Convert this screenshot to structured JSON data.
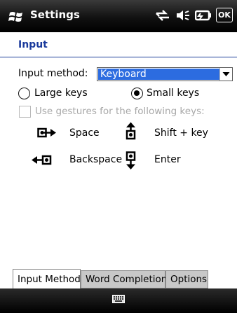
{
  "titlebar": {
    "app_title": "Settings",
    "ok_label": "OK",
    "icons": [
      "windows-logo-icon",
      "connectivity-icon",
      "volume-icon",
      "battery-icon"
    ]
  },
  "page": {
    "title": "Input"
  },
  "input_method": {
    "label": "Input method:",
    "value": "Keyboard",
    "options": [
      "Keyboard"
    ]
  },
  "keys": {
    "large_label": "Large keys",
    "small_label": "Small keys",
    "selected": "small"
  },
  "gestures": {
    "checkbox_label": "Use gestures for the following keys:",
    "checked": false,
    "enabled": false,
    "items": [
      {
        "label": "Space",
        "icon": "space-gesture-icon"
      },
      {
        "label": "Shift + key",
        "icon": "shift-gesture-icon"
      },
      {
        "label": "Backspace",
        "icon": "backspace-gesture-icon"
      },
      {
        "label": "Enter",
        "icon": "enter-gesture-icon"
      }
    ]
  },
  "tabs": [
    {
      "label": "Input Method",
      "active": true
    },
    {
      "label": "Word Completion",
      "active": false
    },
    {
      "label": "Options",
      "active": false
    }
  ],
  "bottombar": {
    "icon": "keyboard-icon"
  },
  "colors": {
    "accent": "#1a3a9c",
    "selection": "#2c6ce0",
    "disabled_text": "#a8a8a8"
  }
}
